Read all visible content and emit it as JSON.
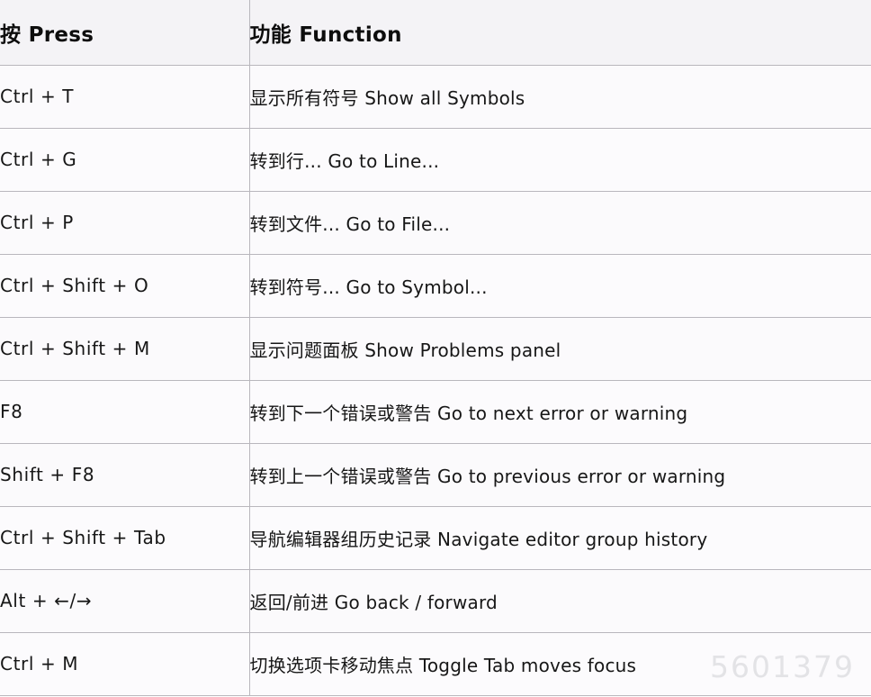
{
  "table": {
    "headers": {
      "press": "按 Press",
      "function": "功能 Function"
    },
    "rows": [
      {
        "press": "Ctrl + T",
        "function": "显示所有符号 Show all Symbols"
      },
      {
        "press": "Ctrl + G",
        "function": "转到行... Go to Line..."
      },
      {
        "press": "Ctrl + P",
        "function": "转到文件... Go to File..."
      },
      {
        "press": "Ctrl + Shift + O",
        "function": "转到符号... Go to Symbol..."
      },
      {
        "press": "Ctrl + Shift + M",
        "function": "显示问题面板 Show Problems panel"
      },
      {
        "press": "F8",
        "function": "转到下一个错误或警告 Go to next error or warning"
      },
      {
        "press": "Shift + F8",
        "function": "转到上一个错误或警告 Go to previous error or warning"
      },
      {
        "press": "Ctrl + Shift + Tab",
        "function": "导航编辑器组历史记录 Navigate editor group history"
      },
      {
        "press": "Alt + ←/→",
        "function": "返回/前进 Go back / forward"
      },
      {
        "press": "Ctrl + M",
        "function": "切换选项卡移动焦点 Toggle Tab moves focus"
      }
    ]
  },
  "watermark": {
    "text": "5601379"
  },
  "colors": {
    "border": "#b9b7bd",
    "header_background": "#f4f3f6",
    "row_background": "#fbfafc",
    "text": "#171717",
    "watermark": "#e3e3e6"
  }
}
